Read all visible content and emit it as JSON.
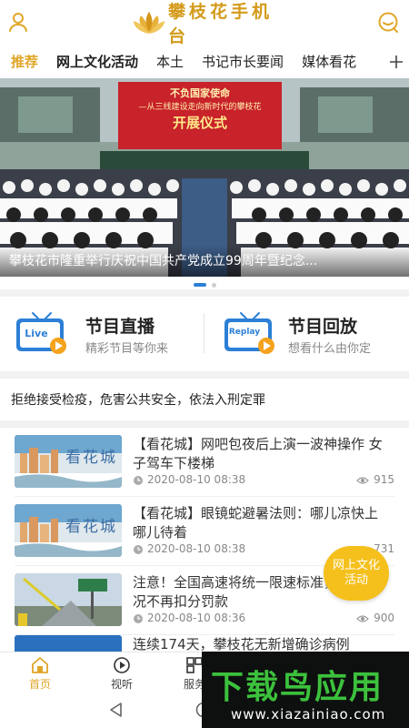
{
  "header": {
    "logo_text": "攀枝花手机台",
    "brand_color": "#d49a1a"
  },
  "tabs": [
    {
      "label": "推荐"
    },
    {
      "label": "网上文化活动"
    },
    {
      "label": "本土"
    },
    {
      "label": "书记市长要闻"
    },
    {
      "label": "媒体看花"
    }
  ],
  "banner": {
    "caption": "攀枝花市隆重举行庆祝中国共产党成立99周年暨纪念...",
    "stage_text_1": "不负国家使命",
    "stage_text_2": "—从三线建设走向新时代的攀枝花",
    "stage_text_3": "开展仪式",
    "slide_count": 2,
    "active_slide": 1
  },
  "programs": [
    {
      "title": "节目直播",
      "subtitle": "精彩节目等你来",
      "icon_label": "Live"
    },
    {
      "title": "节目回放",
      "subtitle": "想看什么由你定",
      "icon_label": "Replay"
    }
  ],
  "notice": "拒绝接受检疫，危害公共安全，依法入刑定罪",
  "news": [
    {
      "title": "【看花城】网吧包夜后上演一波神操作 女子驾车下楼梯",
      "time": "2020-08-10 08:38",
      "views": "915",
      "thumb_text": "看花城"
    },
    {
      "title": "【看花城】眼镜蛇避暑法则：哪儿凉快上哪儿待着",
      "time": "2020-08-10 08:38",
      "views": "731",
      "thumb_text": "看花城"
    },
    {
      "title": "注意！全国高速将统一限速标准，这些情况不再扣分罚款",
      "time": "2020-08-10 08:36",
      "views": "900",
      "thumb_text": ""
    },
    {
      "title": "连续174天，攀枝花无新增确诊病例",
      "time": "",
      "views": "",
      "thumb_text": ""
    }
  ],
  "float_button": {
    "label_1": "网上文化",
    "label_2": "活动"
  },
  "bottom_nav": [
    {
      "label": "首页"
    },
    {
      "label": "视听"
    },
    {
      "label": "服务"
    }
  ],
  "watermark": {
    "main": "下载鸟应用",
    "sub": "www.xiazainiao.com"
  },
  "colors": {
    "accent": "#e0a628",
    "live_blue": "#2b7fd6",
    "float_yellow": "#f5c01c"
  }
}
